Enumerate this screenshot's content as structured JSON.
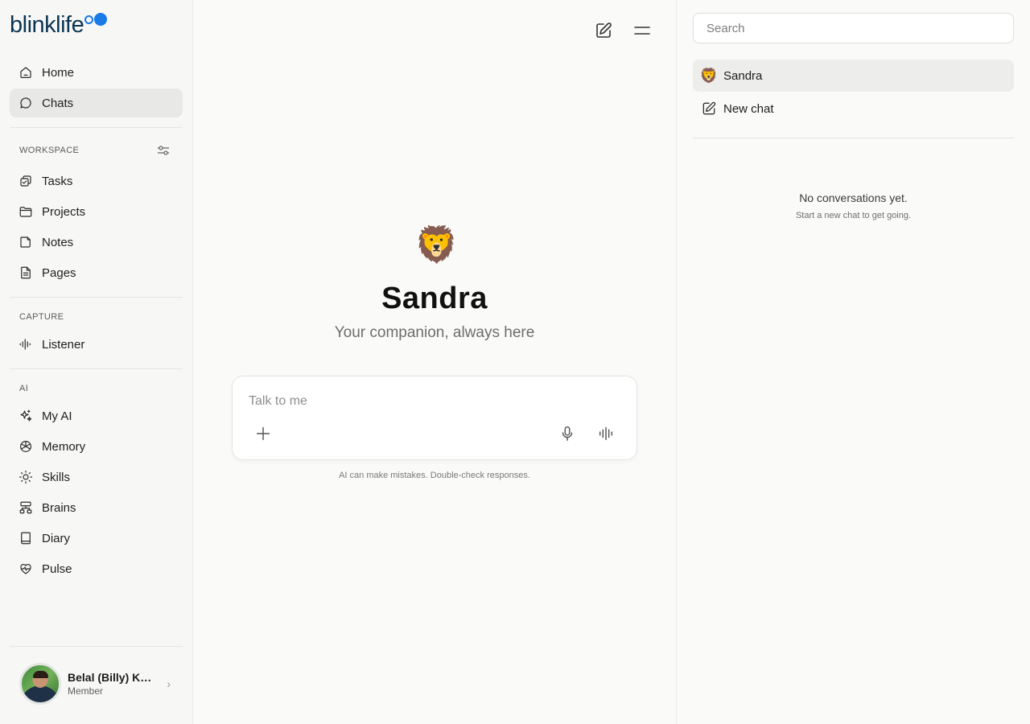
{
  "brand": {
    "name": "blinklife",
    "accent_color": "#1a7ae6",
    "text_color": "#0a3552"
  },
  "sidebar": {
    "primary": [
      {
        "label": "Home",
        "icon": "home-icon",
        "active": false
      },
      {
        "label": "Chats",
        "icon": "chat-bubble-icon",
        "active": true
      }
    ],
    "workspace": {
      "label": "WORKSPACE",
      "settings_icon": "sliders-icon",
      "items": [
        {
          "label": "Tasks",
          "icon": "tasks-icon"
        },
        {
          "label": "Projects",
          "icon": "folder-icon"
        },
        {
          "label": "Notes",
          "icon": "note-icon"
        },
        {
          "label": "Pages",
          "icon": "document-icon"
        }
      ]
    },
    "capture": {
      "label": "CAPTURE",
      "items": [
        {
          "label": "Listener",
          "icon": "audio-waveform-icon"
        }
      ]
    },
    "ai": {
      "label": "AI",
      "items": [
        {
          "label": "My AI",
          "icon": "sparkles-icon"
        },
        {
          "label": "Memory",
          "icon": "memory-icon"
        },
        {
          "label": "Skills",
          "icon": "sun-icon"
        },
        {
          "label": "Brains",
          "icon": "network-icon"
        },
        {
          "label": "Diary",
          "icon": "book-icon"
        },
        {
          "label": "Pulse",
          "icon": "heart-pulse-icon"
        }
      ]
    },
    "user": {
      "name": "Belal (Billy) Kh...",
      "role": "Member",
      "chevron": "›"
    }
  },
  "header": {
    "icons": [
      "new-chat-icon",
      "menu-icon"
    ]
  },
  "companion": {
    "emoji": "🦁",
    "name": "Sandra",
    "tagline": "Your companion, always here"
  },
  "composer": {
    "placeholder": "Talk to me",
    "value": "",
    "buttons": [
      "plus-icon",
      "microphone-icon",
      "voice-waveform-icon"
    ],
    "disclaimer": "AI can make mistakes. Double-check responses."
  },
  "right_panel": {
    "search_placeholder": "Search",
    "conversations": [
      {
        "label": "Sandra",
        "emoji": "🦁",
        "active": true
      }
    ],
    "new_chat_label": "New chat",
    "empty_title": "No conversations yet.",
    "empty_subtitle": "Start a new chat to get going."
  }
}
